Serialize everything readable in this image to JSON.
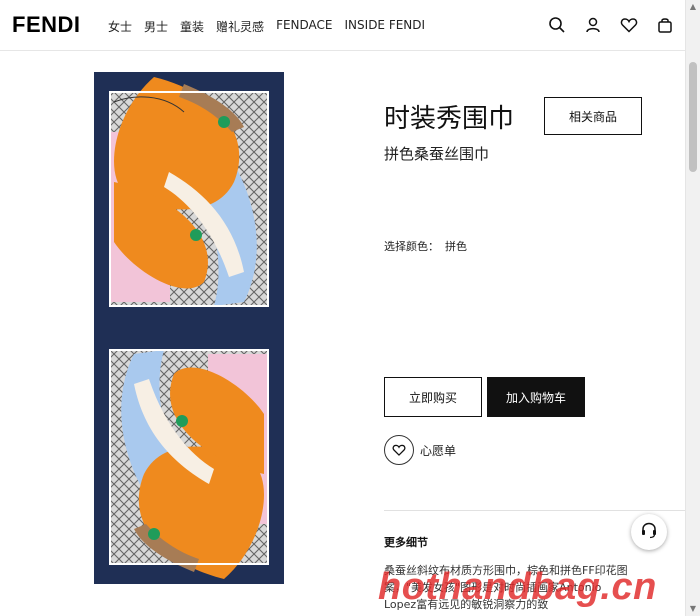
{
  "header": {
    "logo": "FENDI",
    "nav": [
      "女士",
      "男士",
      "童装",
      "赠礼灵感",
      "FENDACE",
      "INSIDE FENDI"
    ],
    "icons": [
      "search-icon",
      "user-icon",
      "heart-icon",
      "bag-icon"
    ]
  },
  "product": {
    "title": "时装秀围巾",
    "subtitle": "拼色桑蚕丝围巾",
    "related_label": "相关商品",
    "color_label": "选择颜色：",
    "color_value": "拼色",
    "buy_label": "立即购买",
    "cart_label": "加入购物车",
    "wishlist_label": "心愿单",
    "details_title": "更多细节",
    "details_text": "桑蚕丝斜纹布材质方形围巾，棕色和拼色FF印花图案，\"美发女孩\"图形是对时尚插画家Antonio Lopez富有远见的敏锐洞察力的致"
  },
  "watermark": "hothandbag.cn",
  "colors": {
    "navy": "#1f2f55",
    "orange": "#ef8a1e",
    "light_blue": "#a9c9ee",
    "pink": "#f2c4d8"
  }
}
